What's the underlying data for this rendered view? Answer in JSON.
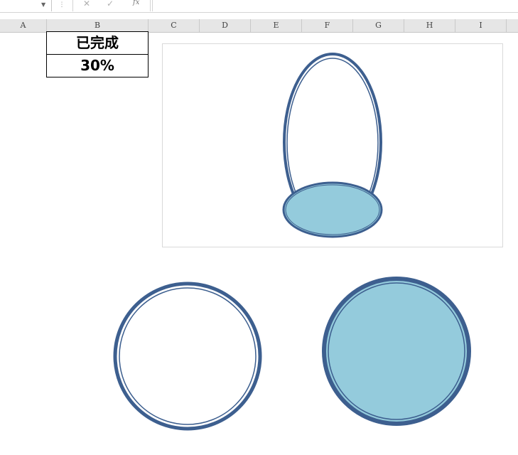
{
  "formula_bar": {
    "name_box_value": "",
    "cancel_icon": "close-icon",
    "enter_icon": "check-icon",
    "fx_label": "fx",
    "formula_value": ""
  },
  "columns": [
    "A",
    "B",
    "C",
    "D",
    "E",
    "F",
    "G",
    "H",
    "I"
  ],
  "cells": {
    "B1": "已完成",
    "B2": "30%"
  },
  "colors": {
    "outline": "#3d5f8f",
    "fill": "#94cbdc",
    "header_bg": "#e6e6e6"
  },
  "shapes": {
    "progress_percent": 30
  }
}
